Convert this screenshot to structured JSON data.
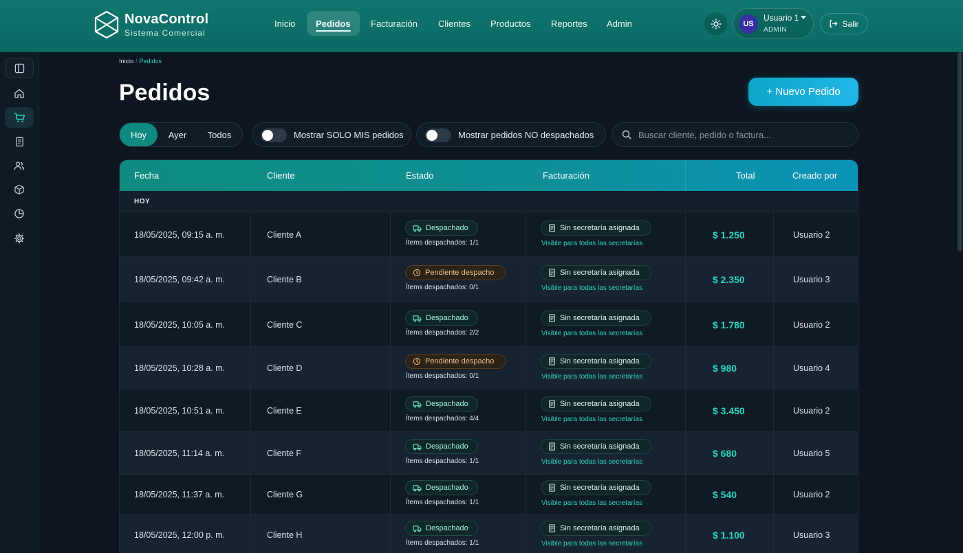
{
  "app": {
    "brand": "NovaControl",
    "subtitle": "Sistema Comercial"
  },
  "nav": {
    "items": [
      {
        "label": "Inicio",
        "active": false
      },
      {
        "label": "Pedidos",
        "active": true
      },
      {
        "label": "Facturación",
        "active": false
      },
      {
        "label": "Clientes",
        "active": false
      },
      {
        "label": "Productos",
        "active": false
      },
      {
        "label": "Reportes",
        "active": false
      },
      {
        "label": "Admin",
        "active": false
      }
    ]
  },
  "user": {
    "initials": "US",
    "name": "Usuario 1",
    "role": "ADMIN",
    "logout_label": "Salir"
  },
  "sidebar": {
    "icons": [
      "panel-icon",
      "home-icon",
      "cart-icon",
      "document-icon",
      "users-icon",
      "box-icon",
      "chart-pie-icon",
      "gear-icon"
    ],
    "active_index": 2
  },
  "breadcrumb": {
    "home": "Inicio",
    "separator": "/",
    "current": "Pedidos"
  },
  "page": {
    "title": "Pedidos",
    "new_button": "+ Nuevo Pedido"
  },
  "filters": {
    "segments": [
      "Hoy",
      "Ayer",
      "Todos"
    ],
    "active_segment": "Hoy",
    "toggle_mine": {
      "label": "Mostrar SOLO MIS pedidos",
      "on": false
    },
    "toggle_undispatched": {
      "label": "Mostrar pedidos NO despachados",
      "on": false
    },
    "search_placeholder": "Buscar cliente, pedido o factura..."
  },
  "table": {
    "headers": {
      "fecha": "Fecha",
      "cliente": "Cliente",
      "estado": "Estado",
      "facturacion": "Facturación",
      "total": "Total",
      "creado": "Creado por"
    },
    "group_label": "HOY",
    "rows": [
      {
        "fecha": "18/05/2025, 09:15 a. m.",
        "cliente": "Cliente A",
        "estado": "Despachado",
        "estado_tipo": "ok",
        "items": "Ítems despachados: 1/1",
        "facturacion": "Sin secretaría asignada",
        "visible": "Visible para todas las secretarías",
        "total": "$ 1.250",
        "creado": "Usuario 2"
      },
      {
        "fecha": "18/05/2025, 09:42 a. m.",
        "cliente": "Cliente B",
        "estado": "Pendiente despacho",
        "estado_tipo": "pend",
        "items": "Ítems despachados: 0/1",
        "facturacion": "Sin secretaría asignada",
        "visible": "Visible para todas las secretarías",
        "total": "$ 2.350",
        "creado": "Usuario 3"
      },
      {
        "fecha": "18/05/2025, 10:05 a. m.",
        "cliente": "Cliente C",
        "estado": "Despachado",
        "estado_tipo": "ok",
        "items": "Ítems despachados: 2/2",
        "facturacion": "Sin secretaría asignada",
        "visible": "Visible para todas las secretarías",
        "total": "$ 1.780",
        "creado": "Usuario 2"
      },
      {
        "fecha": "18/05/2025, 10:28 a. m.",
        "cliente": "Cliente D",
        "estado": "Pendiente despacho",
        "estado_tipo": "pend",
        "items": "Ítems despachados: 0/1",
        "facturacion": "Sin secretaría asignada",
        "visible": "Visible para todas las secretarías",
        "total": "$ 980",
        "creado": "Usuario 4"
      },
      {
        "fecha": "18/05/2025, 10:51 a. m.",
        "cliente": "Cliente E",
        "estado": "Despachado",
        "estado_tipo": "ok",
        "items": "Ítems despachados: 4/4",
        "facturacion": "Sin secretaría asignada",
        "visible": "Visible para todas las secretarías",
        "total": "$ 3.450",
        "creado": "Usuario 2"
      },
      {
        "fecha": "18/05/2025, 11:14 a. m.",
        "cliente": "Cliente F",
        "estado": "Despachado",
        "estado_tipo": "ok",
        "items": "Ítems despachados: 1/1",
        "facturacion": "Sin secretaría asignada",
        "visible": "Visible para todas las secretarías",
        "total": "$ 680",
        "creado": "Usuario 5"
      },
      {
        "fecha": "18/05/2025, 11:37 a. m.",
        "cliente": "Cliente G",
        "estado": "Despachado",
        "estado_tipo": "ok",
        "items": "Ítems despachados: 1/1",
        "facturacion": "Sin secretaría asignada",
        "visible": "Visible para todas las secretarías",
        "total": "$ 540",
        "creado": "Usuario 2"
      },
      {
        "fecha": "18/05/2025, 12:00 p. m.",
        "cliente": "Cliente H",
        "estado": "Despachado",
        "estado_tipo": "ok",
        "items": "Ítems despachados: 1/1",
        "facturacion": "Sin secretaría asignada",
        "visible": "Visible para todas las secretarías",
        "total": "$ 1.100",
        "creado": "Usuario 3"
      }
    ]
  },
  "colors": {
    "header_teal": "#0f766e",
    "accent": "#2dd4bf",
    "button_blue": "#0ea5c9",
    "pending": "#f5c48a",
    "background": "#0d1620"
  }
}
